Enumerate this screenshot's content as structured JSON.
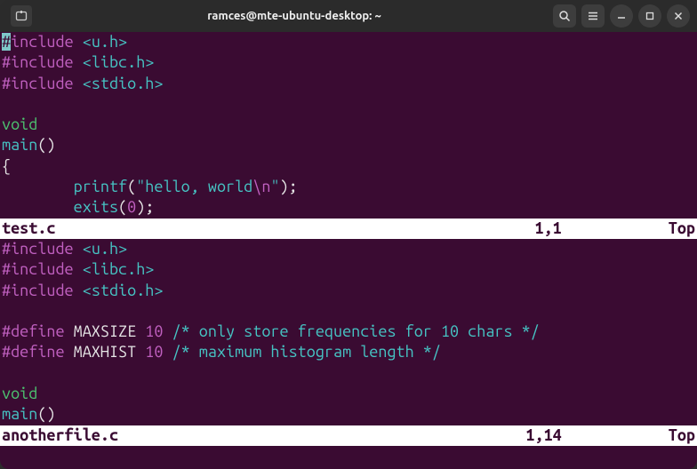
{
  "window": {
    "title": "ramces@mte-ubuntu-desktop: ~",
    "tab_icon": "terminal-tab-icon",
    "buttons": {
      "search": "search-icon",
      "menu": "hamburger-icon",
      "minimize": "minimize-icon",
      "maximize": "maximize-icon",
      "close": "close-icon"
    }
  },
  "panes": [
    {
      "filename": "test.c",
      "cursor_pos": "1,1",
      "scroll_label": "Top",
      "cursor_on_first_char": true,
      "lines": [
        {
          "tokens": [
            {
              "t": "#",
              "c": "pre",
              "cursor": true
            },
            {
              "t": "include ",
              "c": "pre"
            },
            {
              "t": "<u.h>",
              "c": "str"
            }
          ]
        },
        {
          "tokens": [
            {
              "t": "#include ",
              "c": "pre"
            },
            {
              "t": "<libc.h>",
              "c": "str"
            }
          ]
        },
        {
          "tokens": [
            {
              "t": "#include ",
              "c": "pre"
            },
            {
              "t": "<stdio.h>",
              "c": "str"
            }
          ]
        },
        {
          "tokens": []
        },
        {
          "tokens": [
            {
              "t": "void",
              "c": "type"
            }
          ]
        },
        {
          "tokens": [
            {
              "t": "main",
              "c": "func"
            },
            {
              "t": "()",
              "c": "plain"
            }
          ]
        },
        {
          "tokens": [
            {
              "t": "{",
              "c": "plain"
            }
          ]
        },
        {
          "tokens": [
            {
              "t": "        ",
              "c": "plain"
            },
            {
              "t": "printf",
              "c": "func"
            },
            {
              "t": "(",
              "c": "plain"
            },
            {
              "t": "\"hello, world",
              "c": "str"
            },
            {
              "t": "\\n",
              "c": "pre"
            },
            {
              "t": "\"",
              "c": "str"
            },
            {
              "t": ");",
              "c": "plain"
            }
          ]
        },
        {
          "tokens": [
            {
              "t": "        ",
              "c": "plain"
            },
            {
              "t": "exits",
              "c": "func"
            },
            {
              "t": "(",
              "c": "plain"
            },
            {
              "t": "0",
              "c": "num"
            },
            {
              "t": ");",
              "c": "plain"
            }
          ]
        }
      ]
    },
    {
      "filename": "anotherfile.c",
      "cursor_pos": "1,14",
      "scroll_label": "Top",
      "lines": [
        {
          "tokens": [
            {
              "t": "#include ",
              "c": "pre"
            },
            {
              "t": "<u.h>",
              "c": "str"
            }
          ]
        },
        {
          "tokens": [
            {
              "t": "#include ",
              "c": "pre"
            },
            {
              "t": "<libc.h>",
              "c": "str"
            }
          ]
        },
        {
          "tokens": [
            {
              "t": "#include ",
              "c": "pre"
            },
            {
              "t": "<stdio.h>",
              "c": "str"
            }
          ]
        },
        {
          "tokens": []
        },
        {
          "tokens": [
            {
              "t": "#define ",
              "c": "pre"
            },
            {
              "t": "MAXSIZE ",
              "c": "plain"
            },
            {
              "t": "10",
              "c": "num"
            },
            {
              "t": " ",
              "c": "plain"
            },
            {
              "t": "/* only store frequencies for 10 chars */",
              "c": "str"
            }
          ]
        },
        {
          "tokens": [
            {
              "t": "#define ",
              "c": "pre"
            },
            {
              "t": "MAXHIST ",
              "c": "plain"
            },
            {
              "t": "10",
              "c": "num"
            },
            {
              "t": " ",
              "c": "plain"
            },
            {
              "t": "/* maximum histogram length */",
              "c": "str"
            }
          ]
        },
        {
          "tokens": []
        },
        {
          "tokens": [
            {
              "t": "void",
              "c": "type"
            }
          ]
        },
        {
          "tokens": [
            {
              "t": "main",
              "c": "func"
            },
            {
              "t": "()",
              "c": "plain"
            }
          ]
        }
      ]
    }
  ]
}
